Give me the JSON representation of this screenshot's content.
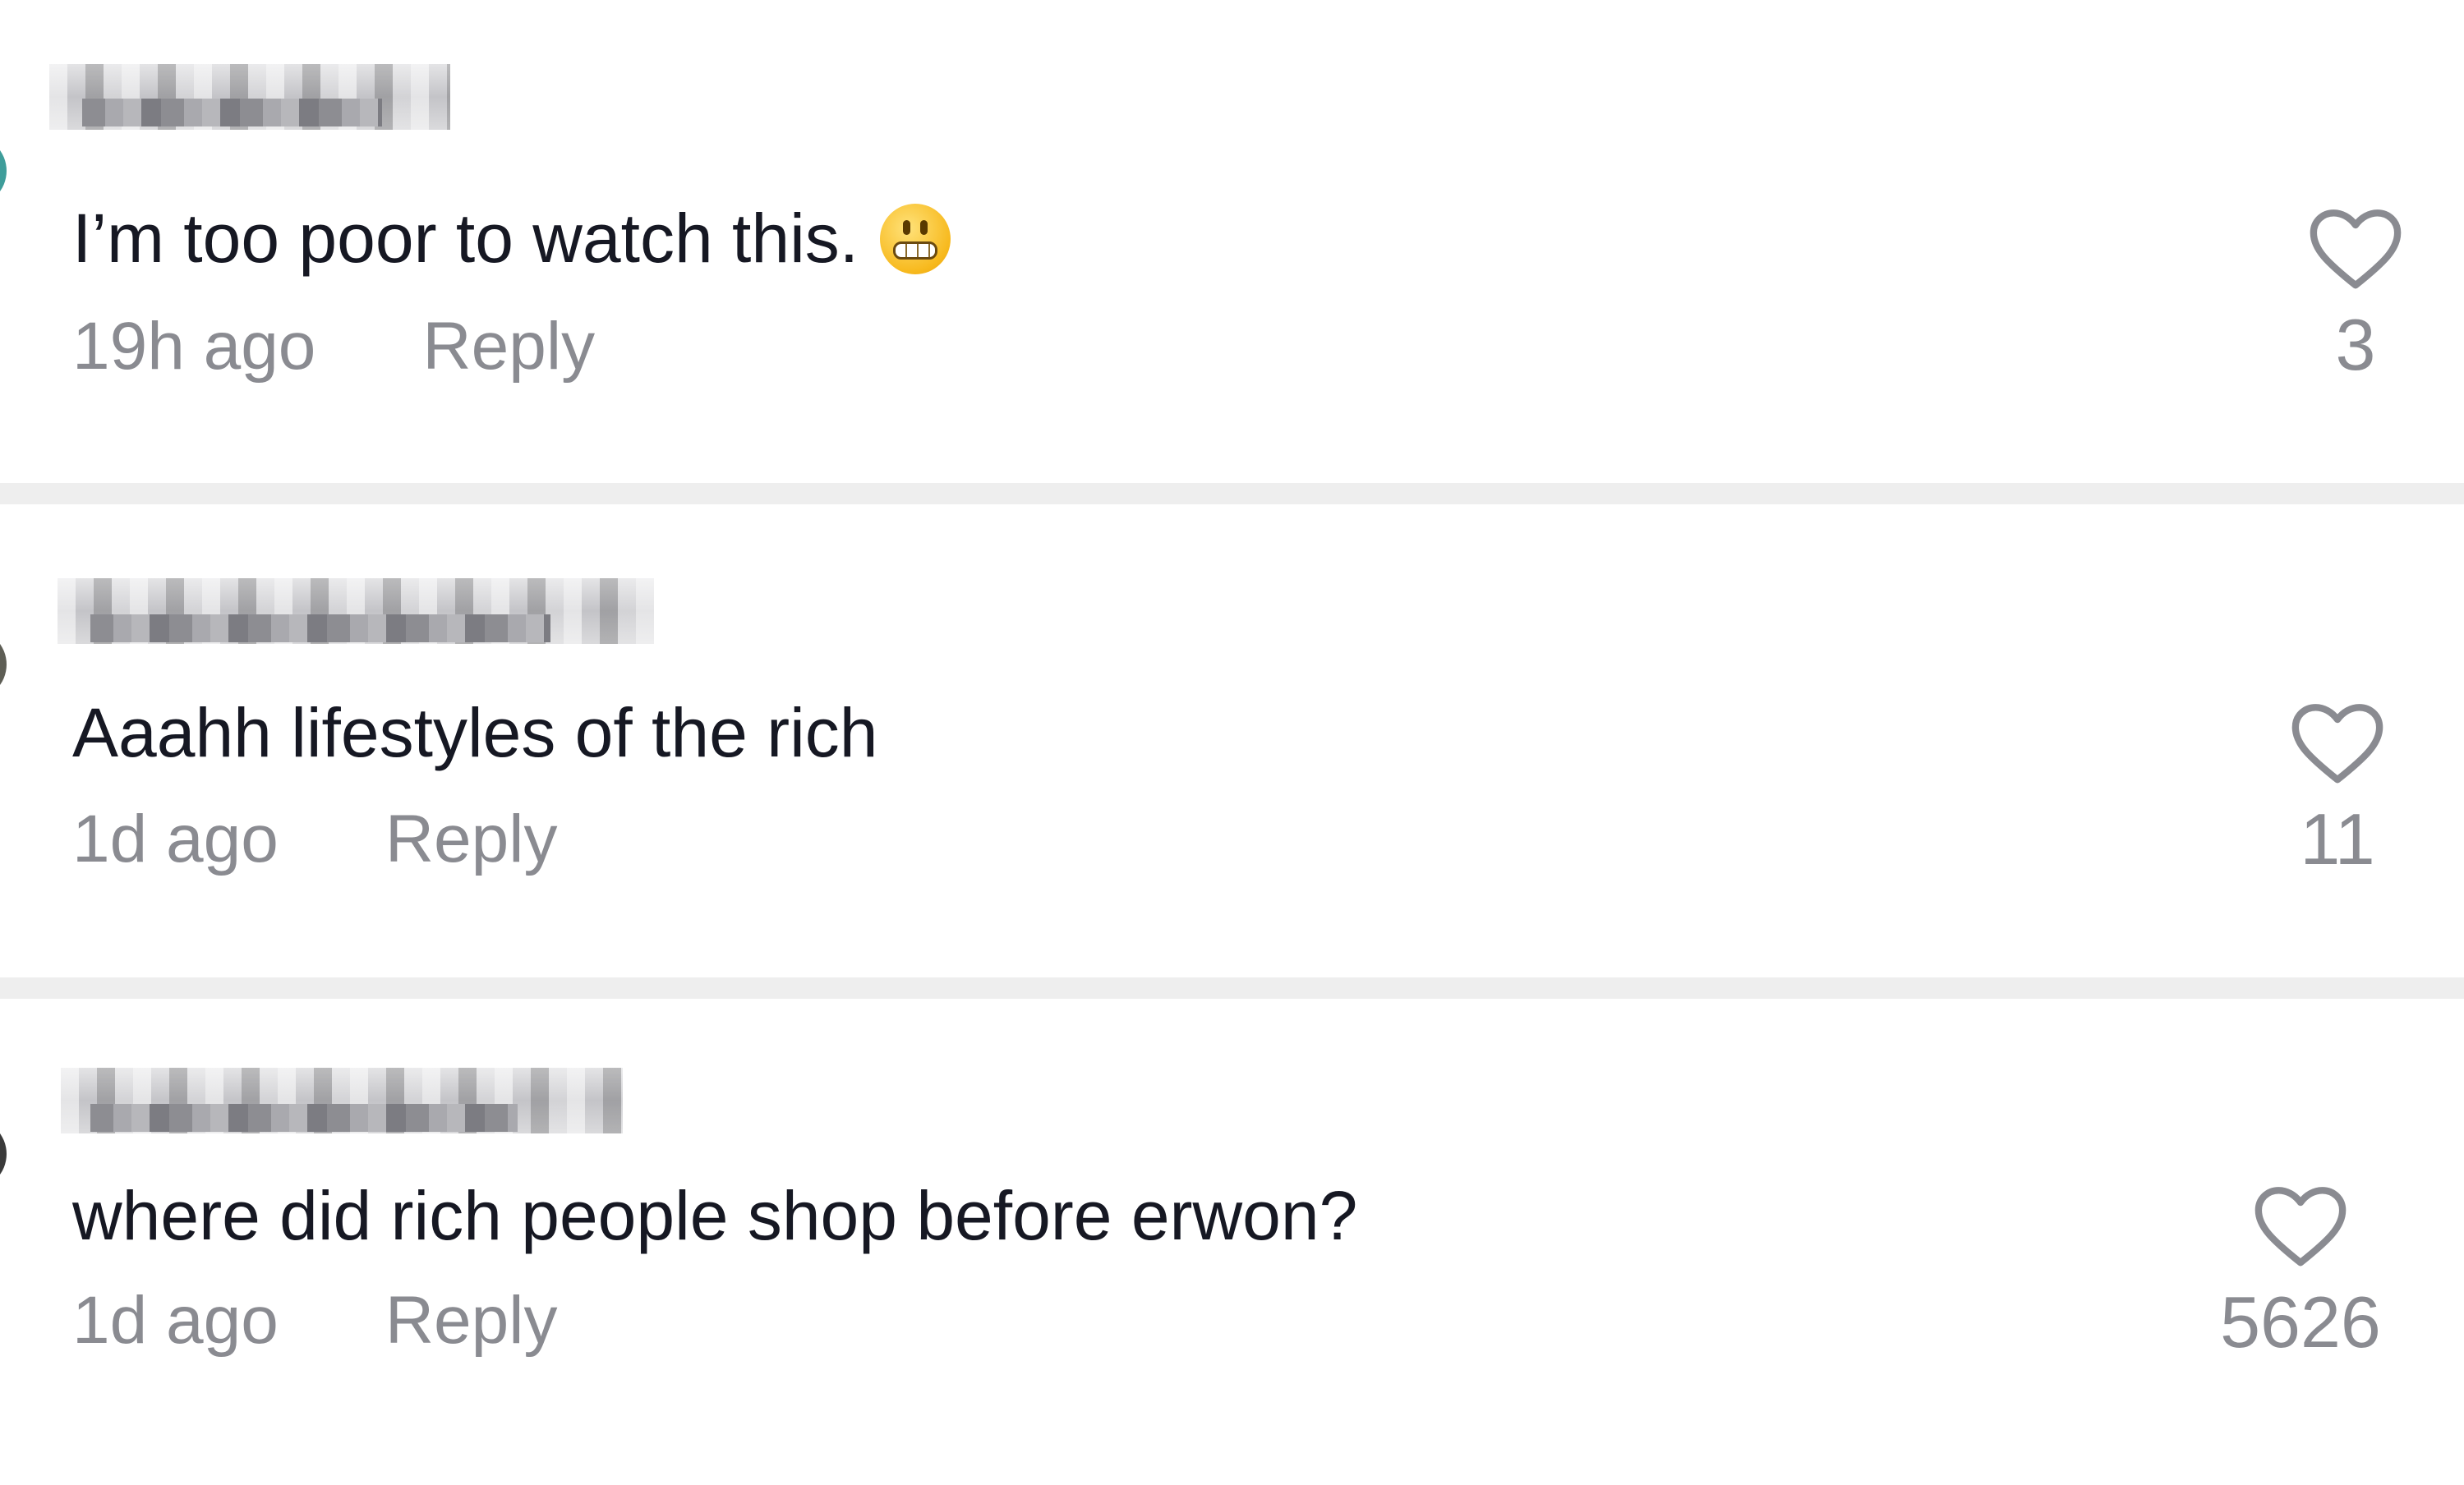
{
  "comments": [
    {
      "text": "I’m too poor to watch this.",
      "emoji": "grimacing-face",
      "time": "19h ago",
      "reply_label": "Reply",
      "likes": "3"
    },
    {
      "text": "Aaahh lifestyles of the rich",
      "time": "1d ago",
      "reply_label": "Reply",
      "likes": "11"
    },
    {
      "text": "where did rich people shop before erwon?",
      "time": "1d ago",
      "reply_label": "Reply",
      "likes": "5626"
    }
  ],
  "icons": {
    "like": "heart-outline-icon",
    "emoji": "grimacing-face-emoji-icon"
  },
  "colors": {
    "primary_text": "#161823",
    "secondary_text": "#8a8b91",
    "divider": "#eeeeee",
    "background": "#ffffff"
  }
}
